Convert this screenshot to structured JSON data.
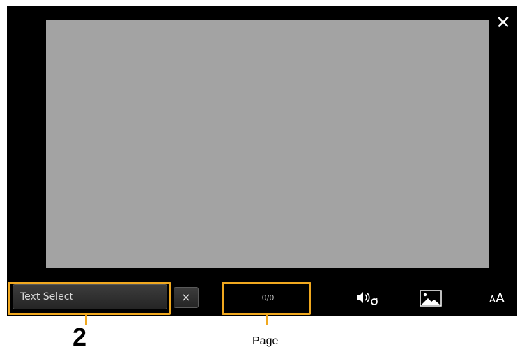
{
  "window": {
    "close_icon": "close-icon"
  },
  "toolbar": {
    "text_select_label": "Text Select",
    "clear_icon": "×",
    "page_value": "0/0",
    "icons": {
      "speaker": "speaker-repeat-icon",
      "picture": "picture-icon",
      "font_size_small": "A",
      "font_size_big": "A"
    }
  },
  "annotations": {
    "callout_number": "2",
    "page_label": "Page",
    "highlight_color": "#f0a81f"
  },
  "colors": {
    "screen_background": "#000000",
    "display_area": "#a3a3a3"
  }
}
